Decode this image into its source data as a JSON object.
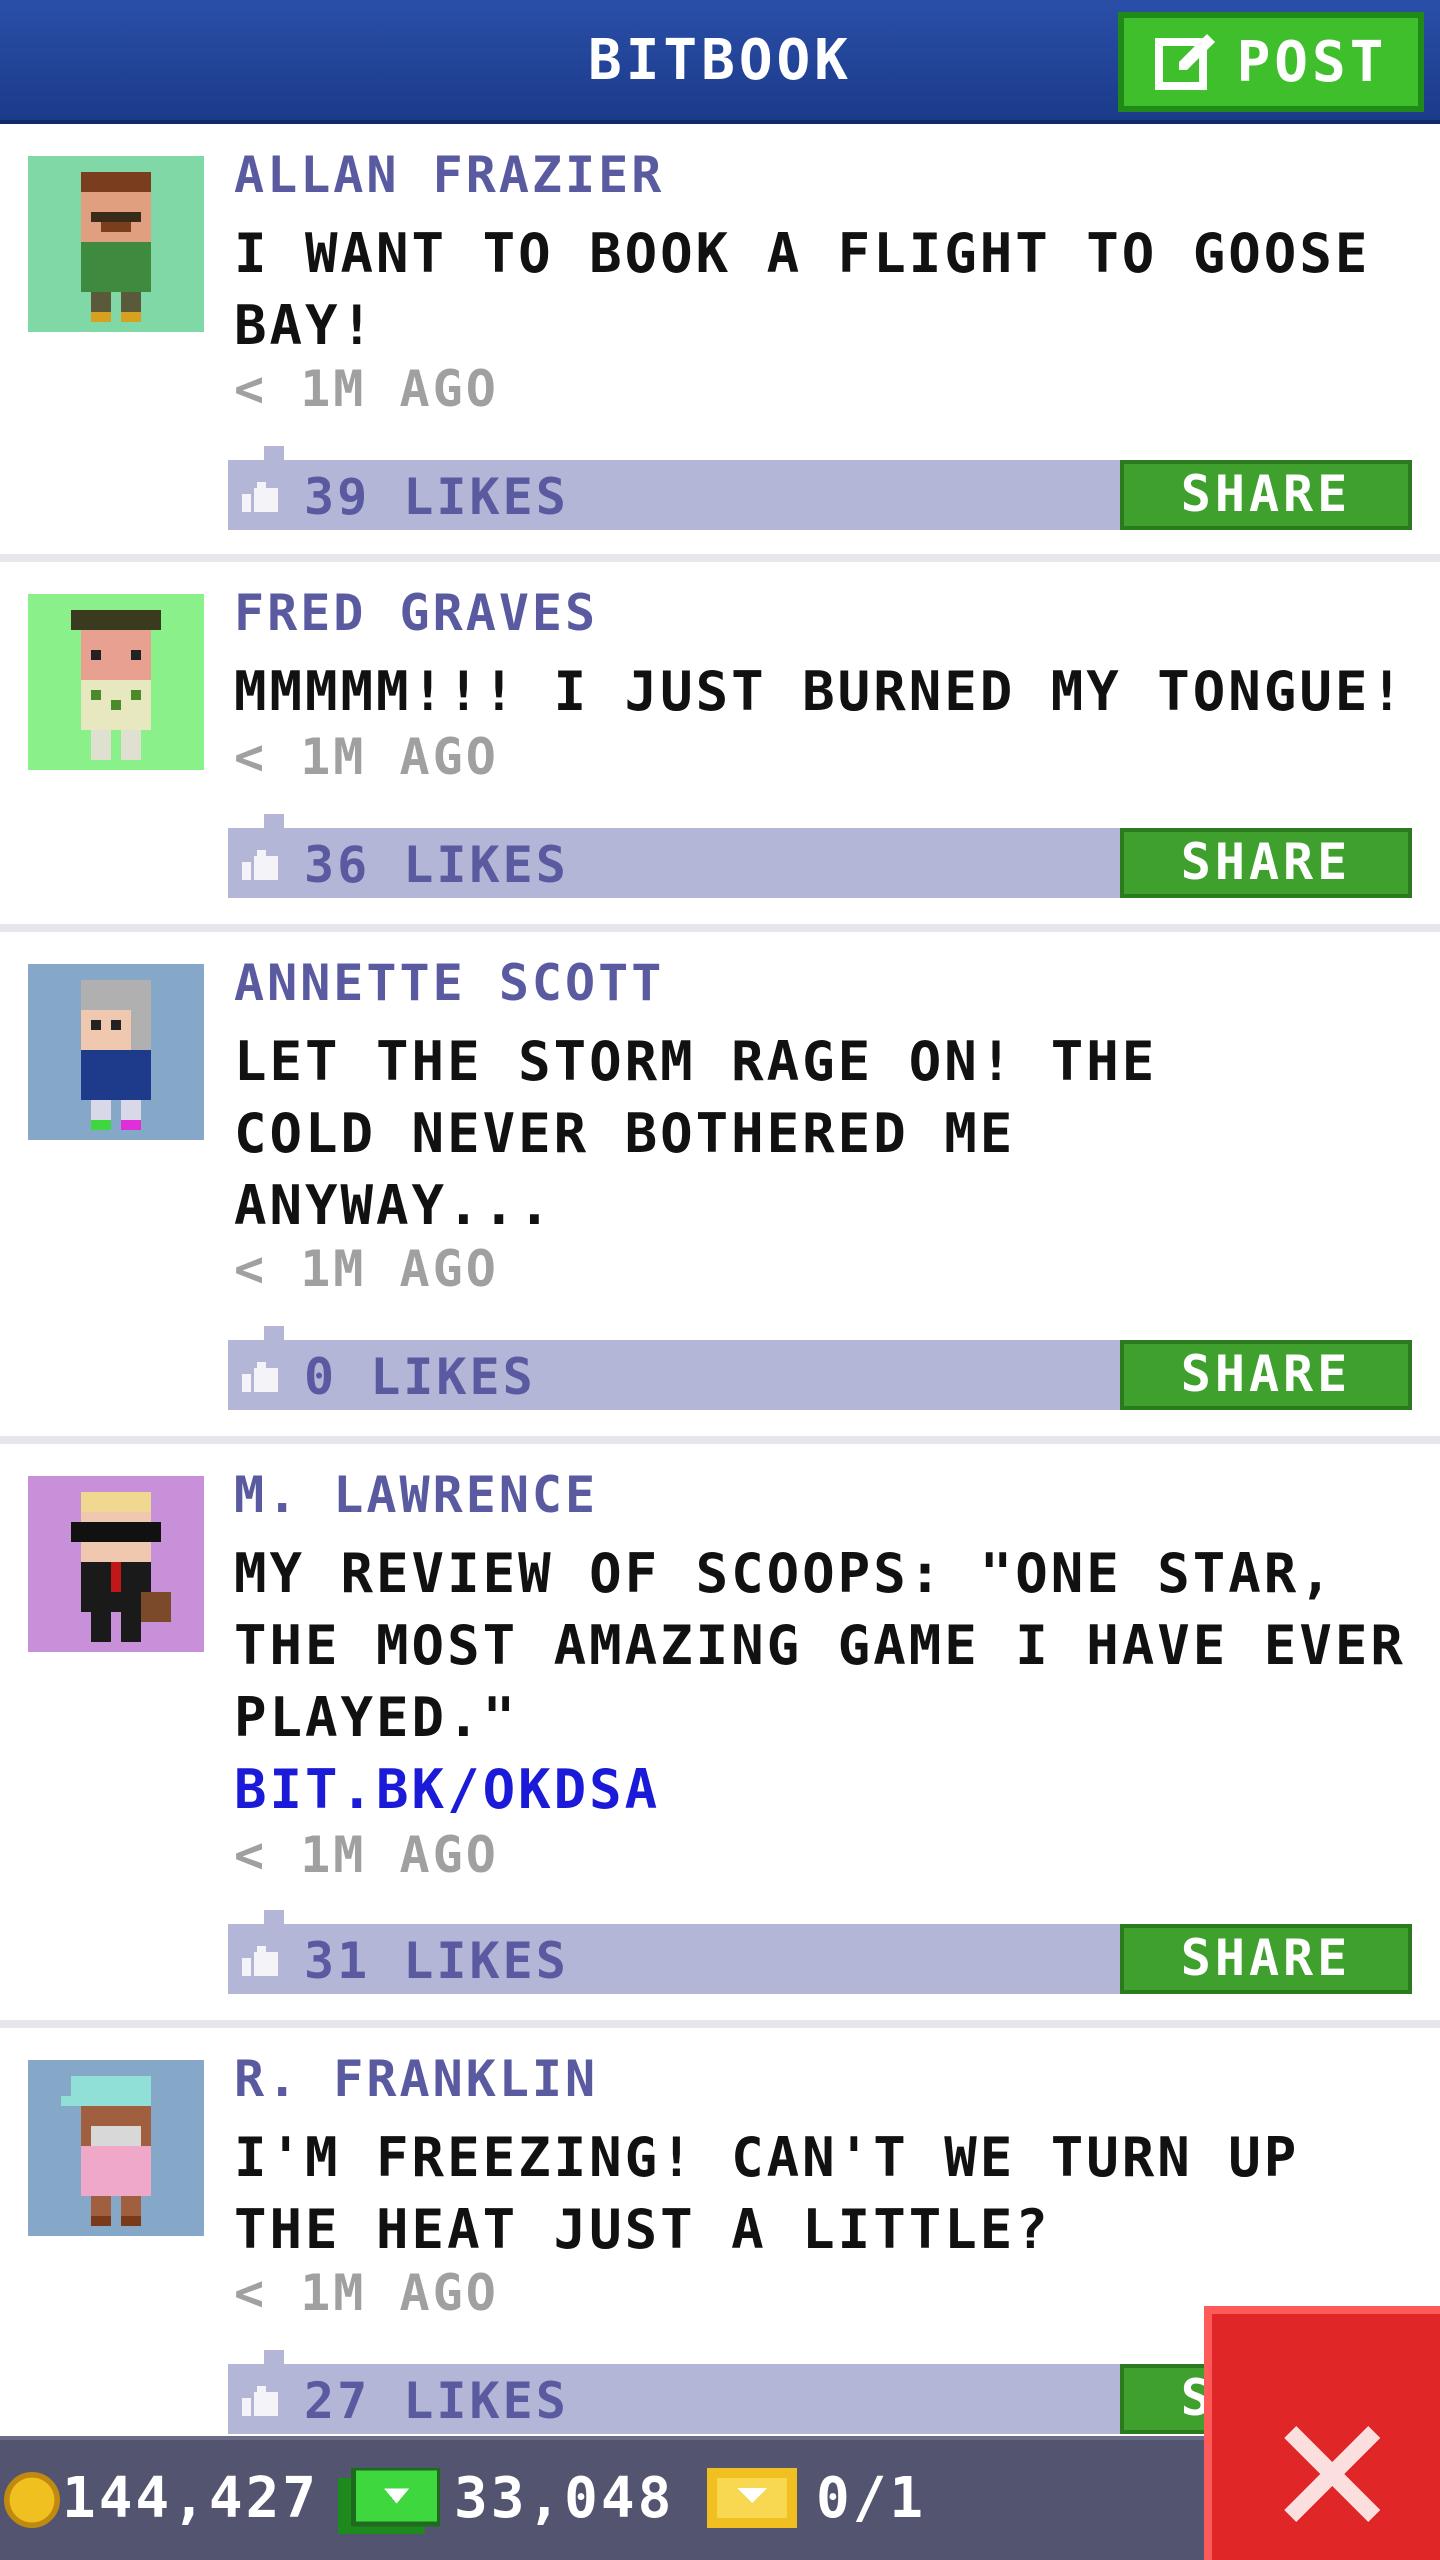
{
  "header": {
    "title": "BITBOOK",
    "post_label": "POST"
  },
  "posts": [
    {
      "author": "ALLAN FRAZIER",
      "message": "I WANT TO BOOK A FLIGHT TO GOOSE BAY!",
      "time": "< 1M AGO",
      "likes": "39 LIKES",
      "share_label": "SHARE",
      "avatar_bg": "#7fd8a6"
    },
    {
      "author": "FRED GRAVES",
      "message": "MMMMM!!! I JUST BURNED MY TONGUE!",
      "time": "< 1M AGO",
      "likes": "36 LIKES",
      "share_label": "SHARE",
      "avatar_bg": "#8af08a"
    },
    {
      "author": "ANNETTE SCOTT",
      "message": "LET THE STORM RAGE ON! THE COLD NEVER BOTHERED ME ANYWAY...",
      "time": "< 1M AGO",
      "likes": "0 LIKES",
      "share_label": "SHARE",
      "avatar_bg": "#86a8c8"
    },
    {
      "author": "M. LAWRENCE",
      "message": "MY REVIEW OF SCOOPS: \"ONE STAR, THE MOST AMAZING GAME I HAVE EVER PLAYED.\"",
      "link": "BIT.BK/OKDSA",
      "time": "< 1M AGO",
      "likes": "31 LIKES",
      "share_label": "SHARE",
      "avatar_bg": "#c890d8"
    },
    {
      "author": "R. FRANKLIN",
      "message": "I'M FREEZING! CAN'T WE TURN UP THE HEAT JUST A LITTLE?",
      "time": "< 1M AGO",
      "likes": "27 LIKES",
      "share_label": "SHARE",
      "avatar_bg": "#86a8c8"
    }
  ],
  "status": {
    "coins": "144,427",
    "bux": "33,048",
    "tickets": "0/1"
  },
  "colors": {
    "header": "#1b3a8a",
    "accent_green": "#3fa02e",
    "author": "#5a5aa0",
    "like_bar": "#b4b6d8",
    "link": "#1a1ad8",
    "close": "#e02626",
    "statusbar": "#525470"
  },
  "icons": {
    "post": "edit-square-icon",
    "like": "thumbs-up-icon",
    "coin": "coin-icon",
    "cash": "bux-cash-icon",
    "ticket": "golden-ticket-icon",
    "close": "close-x-icon"
  }
}
